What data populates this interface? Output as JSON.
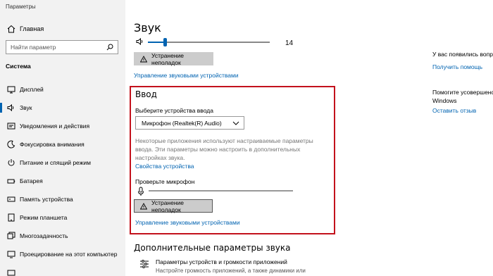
{
  "app_title": "Параметры",
  "sidebar": {
    "home_label": "Главная",
    "search_placeholder": "Найти параметр",
    "section_header": "Система",
    "items": [
      {
        "label": "Дисплей",
        "icon": "monitor-icon"
      },
      {
        "label": "Звук",
        "icon": "speaker-icon",
        "active": true
      },
      {
        "label": "Уведомления и действия",
        "icon": "notification-icon"
      },
      {
        "label": "Фокусировка внимания",
        "icon": "moon-icon"
      },
      {
        "label": "Питание и спящий режим",
        "icon": "power-icon"
      },
      {
        "label": "Батарея",
        "icon": "battery-icon"
      },
      {
        "label": "Память устройства",
        "icon": "storage-icon"
      },
      {
        "label": "Режим планшета",
        "icon": "tablet-icon"
      },
      {
        "label": "Многозадачность",
        "icon": "multitask-icon"
      },
      {
        "label": "Проецирование на этот компьютер",
        "icon": "project-icon"
      }
    ]
  },
  "main": {
    "title": "Звук",
    "volume_value": "14",
    "volume_level": 0.14,
    "troubleshoot_label": "Устранение неполадок",
    "manage_devices_link": "Управление звуковыми устройствами",
    "input": {
      "title": "Ввод",
      "choose_label": "Выберите устройства ввода",
      "selected_device": "Микрофон (Realtek(R) Audio)",
      "description": "Некоторые приложения используют настраиваемые параметры ввода. Эти параметры можно настроить в дополнительных настройках звука.",
      "device_props_link": "Свойства устройства",
      "test_mic_label": "Проверьте микрофон",
      "troubleshoot_label": "Устранение неполадок",
      "manage_devices_link": "Управление звуковыми устройствами"
    },
    "advanced": {
      "title": "Дополнительные параметры звука",
      "item_title": "Параметры устройств и громкости приложений",
      "item_desc": "Настройте громкость приложений, а также динамики или"
    }
  },
  "right": {
    "question_text": "У вас появились вопросы",
    "get_help_link": "Получить помощь",
    "improve_line1": "Помогите усовершенствовать",
    "improve_line2": "Windows",
    "feedback_link": "Оставить отзыв"
  },
  "colors": {
    "accent": "#0063b1",
    "highlight_border": "#c3111c",
    "sidebar_bg": "#f2f2f2"
  }
}
